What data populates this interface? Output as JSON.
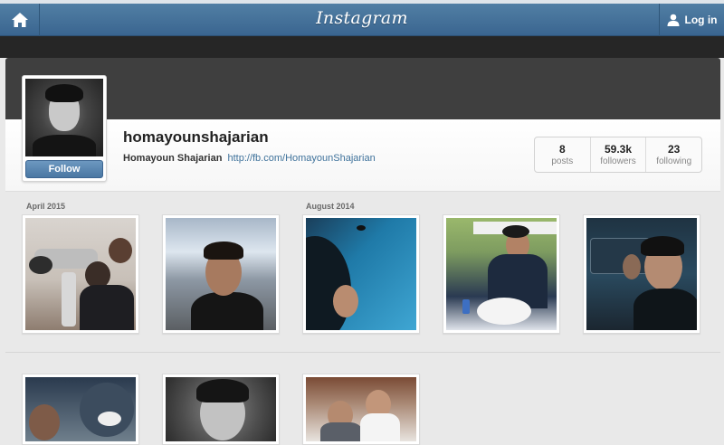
{
  "app": {
    "logo": "Instagram",
    "login_label": "Log in"
  },
  "profile": {
    "username": "homayounshajarian",
    "full_name": "Homayoun Shajarian",
    "website": "http://fb.com/HomayounShajarian",
    "follow_label": "Follow"
  },
  "stats": [
    {
      "value": "8",
      "label": "posts"
    },
    {
      "value": "59.3k",
      "label": "followers"
    },
    {
      "value": "23",
      "label": "following"
    }
  ],
  "date_groups": [
    "April 2015",
    "August 2014"
  ],
  "colors": {
    "nav": "#517fa4",
    "link": "#3f729b",
    "follow": "#4a77a3"
  },
  "icons": {
    "home": "home-icon",
    "login": "user-icon"
  }
}
